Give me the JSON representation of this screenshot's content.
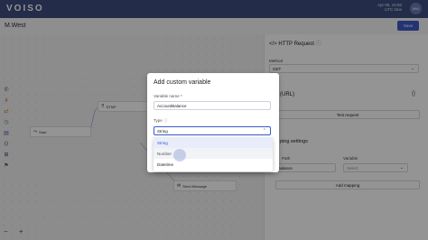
{
  "app": {
    "logo": "VOISO",
    "date": "Apr 05, 15:50",
    "timezone": "UTC time",
    "avatar": "MW"
  },
  "header": {
    "flow_title": "M.West",
    "save_label": "Save"
  },
  "canvas": {
    "nodes": {
      "start": "Start",
      "dtmf": "DTMF",
      "send_message": "Send Message"
    },
    "zoom": {
      "zoom_out": "−",
      "zoom_in": "+"
    }
  },
  "right_panel": {
    "title": "HTTP Request",
    "method_label": "Method",
    "method_value": "GET",
    "url_label": "(URL)",
    "test_request_label": "Test request",
    "mapping_settings_label": "ping settings",
    "path_label": "Path",
    "variable_label": "Variable",
    "path_value": "balance",
    "variable_placeholder": "Select",
    "add_mapping_label": "Add mapping"
  },
  "dialog": {
    "title": "Add custom variable",
    "variable_name_label": "Variable name *",
    "variable_name_value": "AccountBalance",
    "type_label": "Type",
    "type_value": "String",
    "options": [
      "String",
      "Number",
      "Datetime"
    ],
    "selected_option": "String",
    "hovered_option": "Number"
  },
  "colors": {
    "topbar": "#3d4f80",
    "accent": "#3d59c9"
  }
}
